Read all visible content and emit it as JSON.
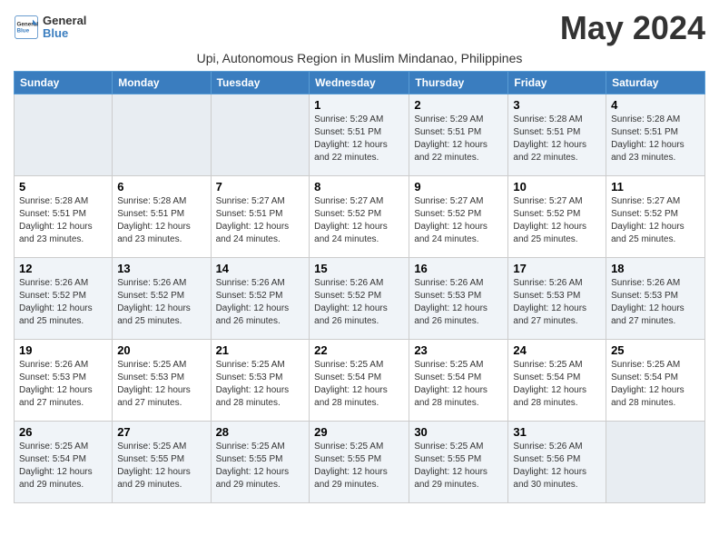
{
  "header": {
    "logo_line1": "General",
    "logo_line2": "Blue",
    "month_title": "May 2024",
    "subtitle": "Upi, Autonomous Region in Muslim Mindanao, Philippines"
  },
  "days_of_week": [
    "Sunday",
    "Monday",
    "Tuesday",
    "Wednesday",
    "Thursday",
    "Friday",
    "Saturday"
  ],
  "weeks": [
    [
      {
        "day": "",
        "info": ""
      },
      {
        "day": "",
        "info": ""
      },
      {
        "day": "",
        "info": ""
      },
      {
        "day": "1",
        "info": "Sunrise: 5:29 AM\nSunset: 5:51 PM\nDaylight: 12 hours\nand 22 minutes."
      },
      {
        "day": "2",
        "info": "Sunrise: 5:29 AM\nSunset: 5:51 PM\nDaylight: 12 hours\nand 22 minutes."
      },
      {
        "day": "3",
        "info": "Sunrise: 5:28 AM\nSunset: 5:51 PM\nDaylight: 12 hours\nand 22 minutes."
      },
      {
        "day": "4",
        "info": "Sunrise: 5:28 AM\nSunset: 5:51 PM\nDaylight: 12 hours\nand 23 minutes."
      }
    ],
    [
      {
        "day": "5",
        "info": "Sunrise: 5:28 AM\nSunset: 5:51 PM\nDaylight: 12 hours\nand 23 minutes."
      },
      {
        "day": "6",
        "info": "Sunrise: 5:28 AM\nSunset: 5:51 PM\nDaylight: 12 hours\nand 23 minutes."
      },
      {
        "day": "7",
        "info": "Sunrise: 5:27 AM\nSunset: 5:51 PM\nDaylight: 12 hours\nand 24 minutes."
      },
      {
        "day": "8",
        "info": "Sunrise: 5:27 AM\nSunset: 5:52 PM\nDaylight: 12 hours\nand 24 minutes."
      },
      {
        "day": "9",
        "info": "Sunrise: 5:27 AM\nSunset: 5:52 PM\nDaylight: 12 hours\nand 24 minutes."
      },
      {
        "day": "10",
        "info": "Sunrise: 5:27 AM\nSunset: 5:52 PM\nDaylight: 12 hours\nand 25 minutes."
      },
      {
        "day": "11",
        "info": "Sunrise: 5:27 AM\nSunset: 5:52 PM\nDaylight: 12 hours\nand 25 minutes."
      }
    ],
    [
      {
        "day": "12",
        "info": "Sunrise: 5:26 AM\nSunset: 5:52 PM\nDaylight: 12 hours\nand 25 minutes."
      },
      {
        "day": "13",
        "info": "Sunrise: 5:26 AM\nSunset: 5:52 PM\nDaylight: 12 hours\nand 25 minutes."
      },
      {
        "day": "14",
        "info": "Sunrise: 5:26 AM\nSunset: 5:52 PM\nDaylight: 12 hours\nand 26 minutes."
      },
      {
        "day": "15",
        "info": "Sunrise: 5:26 AM\nSunset: 5:52 PM\nDaylight: 12 hours\nand 26 minutes."
      },
      {
        "day": "16",
        "info": "Sunrise: 5:26 AM\nSunset: 5:53 PM\nDaylight: 12 hours\nand 26 minutes."
      },
      {
        "day": "17",
        "info": "Sunrise: 5:26 AM\nSunset: 5:53 PM\nDaylight: 12 hours\nand 27 minutes."
      },
      {
        "day": "18",
        "info": "Sunrise: 5:26 AM\nSunset: 5:53 PM\nDaylight: 12 hours\nand 27 minutes."
      }
    ],
    [
      {
        "day": "19",
        "info": "Sunrise: 5:26 AM\nSunset: 5:53 PM\nDaylight: 12 hours\nand 27 minutes."
      },
      {
        "day": "20",
        "info": "Sunrise: 5:25 AM\nSunset: 5:53 PM\nDaylight: 12 hours\nand 27 minutes."
      },
      {
        "day": "21",
        "info": "Sunrise: 5:25 AM\nSunset: 5:53 PM\nDaylight: 12 hours\nand 28 minutes."
      },
      {
        "day": "22",
        "info": "Sunrise: 5:25 AM\nSunset: 5:54 PM\nDaylight: 12 hours\nand 28 minutes."
      },
      {
        "day": "23",
        "info": "Sunrise: 5:25 AM\nSunset: 5:54 PM\nDaylight: 12 hours\nand 28 minutes."
      },
      {
        "day": "24",
        "info": "Sunrise: 5:25 AM\nSunset: 5:54 PM\nDaylight: 12 hours\nand 28 minutes."
      },
      {
        "day": "25",
        "info": "Sunrise: 5:25 AM\nSunset: 5:54 PM\nDaylight: 12 hours\nand 28 minutes."
      }
    ],
    [
      {
        "day": "26",
        "info": "Sunrise: 5:25 AM\nSunset: 5:54 PM\nDaylight: 12 hours\nand 29 minutes."
      },
      {
        "day": "27",
        "info": "Sunrise: 5:25 AM\nSunset: 5:55 PM\nDaylight: 12 hours\nand 29 minutes."
      },
      {
        "day": "28",
        "info": "Sunrise: 5:25 AM\nSunset: 5:55 PM\nDaylight: 12 hours\nand 29 minutes."
      },
      {
        "day": "29",
        "info": "Sunrise: 5:25 AM\nSunset: 5:55 PM\nDaylight: 12 hours\nand 29 minutes."
      },
      {
        "day": "30",
        "info": "Sunrise: 5:25 AM\nSunset: 5:55 PM\nDaylight: 12 hours\nand 29 minutes."
      },
      {
        "day": "31",
        "info": "Sunrise: 5:26 AM\nSunset: 5:56 PM\nDaylight: 12 hours\nand 30 minutes."
      },
      {
        "day": "",
        "info": ""
      }
    ]
  ]
}
